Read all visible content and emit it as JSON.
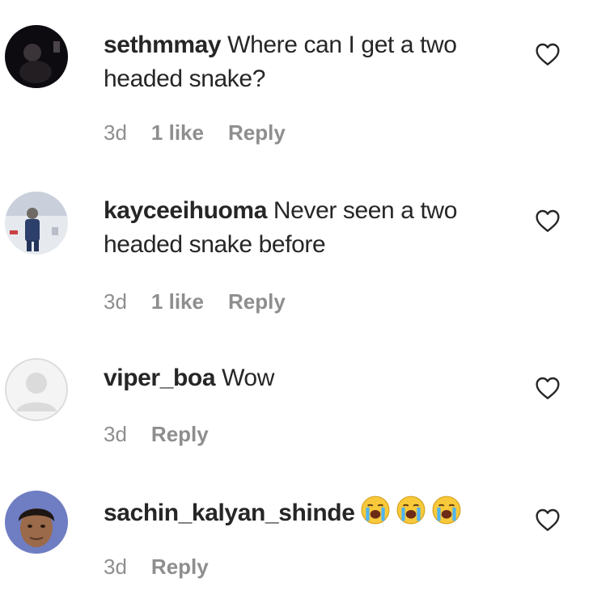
{
  "comments": [
    {
      "username": "sethmmay",
      "text": "Where can I get a two headed snake?",
      "time": "3d",
      "likes": "1 like",
      "reply": "Reply"
    },
    {
      "username": "kayceeihuoma",
      "text": "Never seen a two headed snake before",
      "time": "3d",
      "likes": "1 like",
      "reply": "Reply"
    },
    {
      "username": "viper_boa",
      "text": "Wow",
      "time": "3d",
      "reply": "Reply"
    },
    {
      "username": "sachin_kalyan_shinde",
      "text": "",
      "emoji": [
        "loudly-crying-face",
        "loudly-crying-face",
        "loudly-crying-face"
      ],
      "time": "3d",
      "reply": "Reply"
    }
  ],
  "icons": {
    "like": "heart-outline-icon"
  }
}
